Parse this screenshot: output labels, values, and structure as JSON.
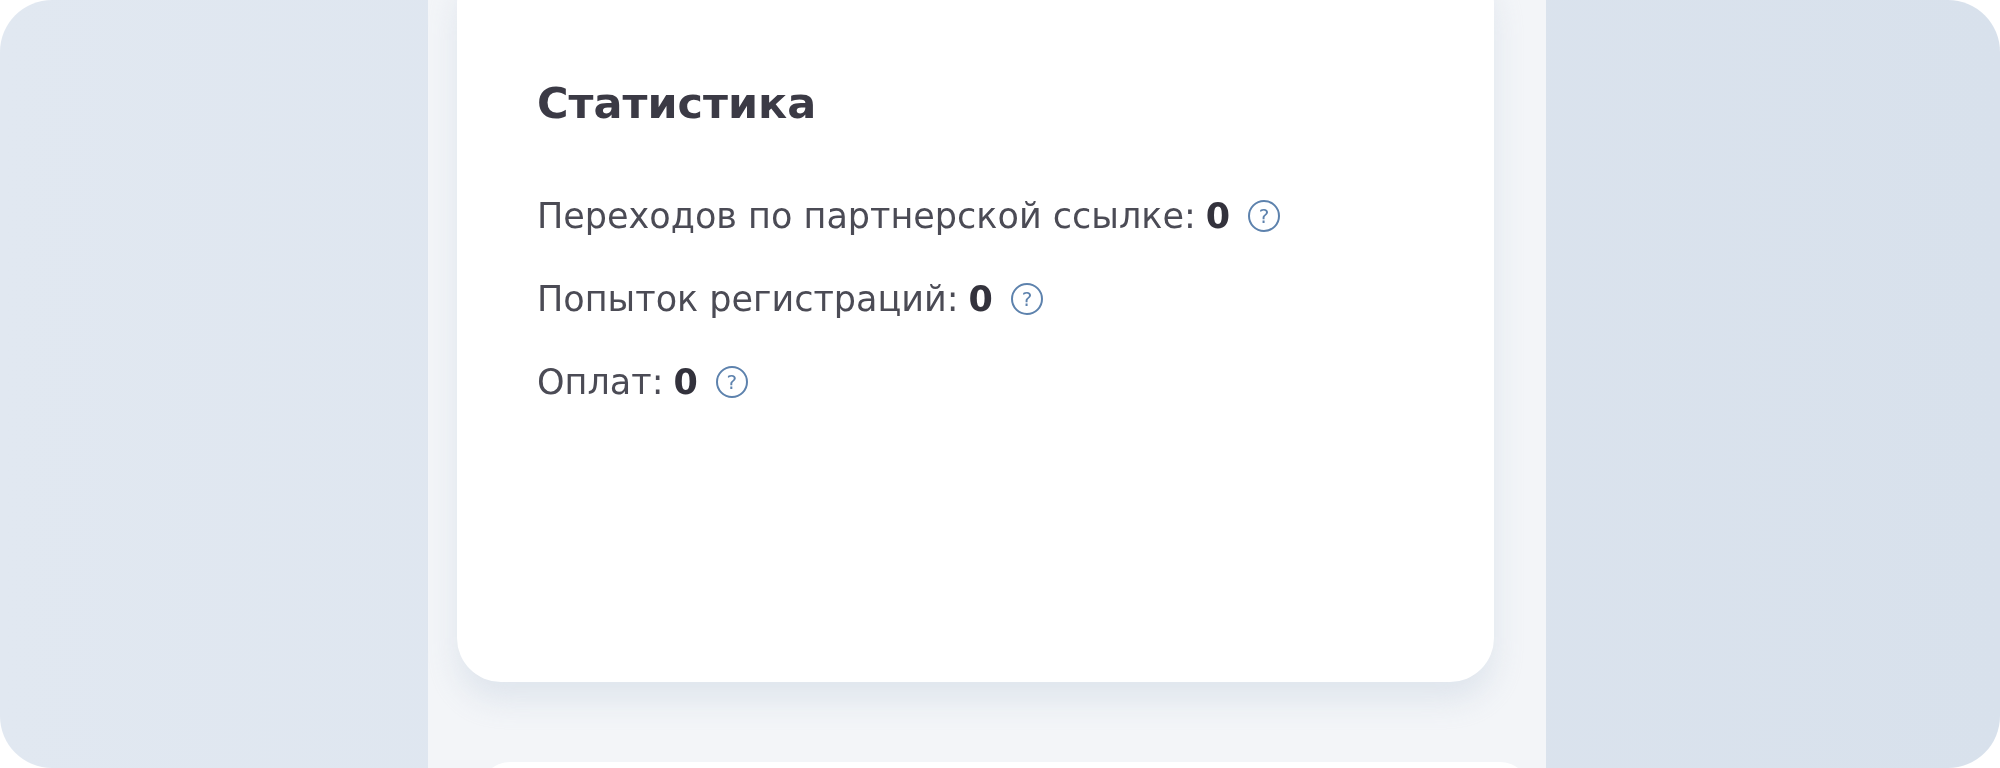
{
  "stats_card": {
    "title": "Статистика",
    "rows": [
      {
        "label": "Переходов по партнерской ссылке:",
        "value": "0",
        "help_icon": "?"
      },
      {
        "label": "Попыток регистраций:",
        "value": "0",
        "help_icon": "?"
      },
      {
        "label": "Оплат:",
        "value": "0",
        "help_icon": "?"
      }
    ]
  }
}
